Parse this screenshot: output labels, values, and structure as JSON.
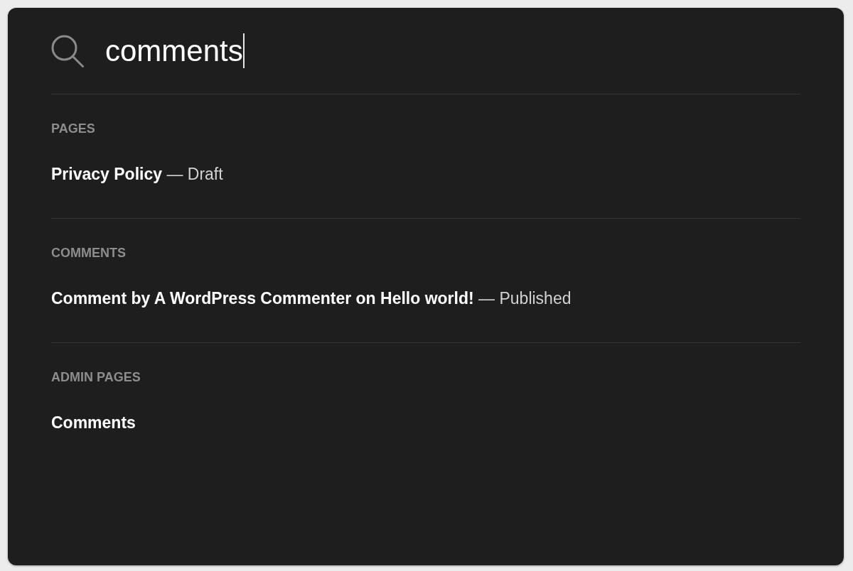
{
  "search": {
    "value": "comments",
    "focused": true
  },
  "sections": [
    {
      "heading": "PAGES",
      "results": [
        {
          "title": "Privacy Policy",
          "detail": "— Draft"
        }
      ]
    },
    {
      "heading": "COMMENTS",
      "results": [
        {
          "title": "Comment by A WordPress Commenter on Hello world!",
          "detail": "— Published"
        }
      ]
    },
    {
      "heading": "ADMIN PAGES",
      "results": [
        {
          "title": "Comments"
        }
      ]
    }
  ]
}
